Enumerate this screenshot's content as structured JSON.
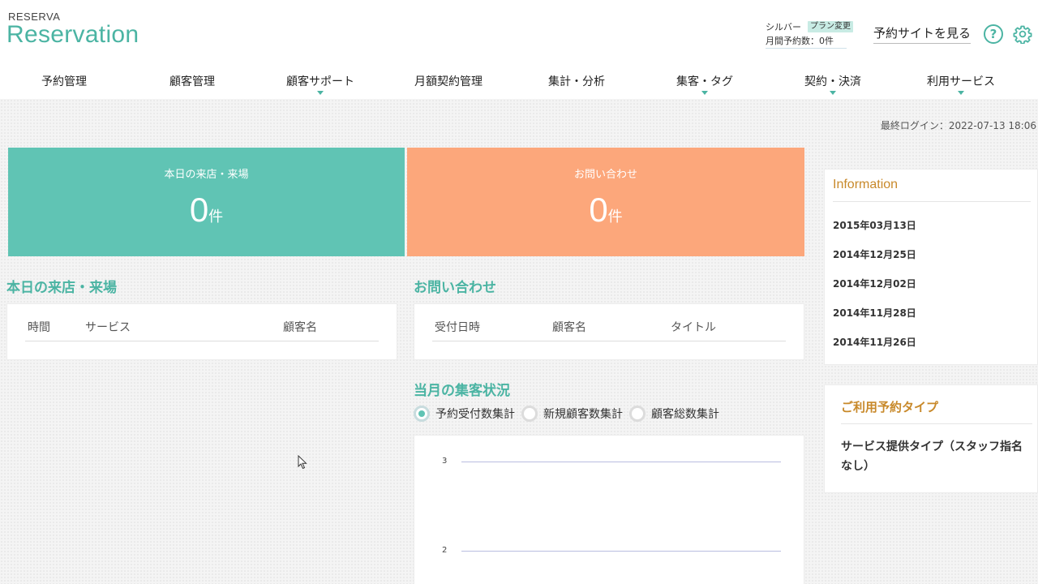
{
  "brand": {
    "small": "RESERVA",
    "big": "Reservation"
  },
  "plan": {
    "name": "シルバー",
    "change_label": "プラン変更",
    "monthly": "月間予約数：0件"
  },
  "header": {
    "view_site": "予約サイトを見る",
    "help_symbol": "?"
  },
  "icons": {
    "help": "question-circle-icon",
    "settings": "gear-icon",
    "cursor": "mouse-pointer-icon"
  },
  "nav": [
    {
      "label": "予約管理",
      "dropdown": false
    },
    {
      "label": "顧客管理",
      "dropdown": false
    },
    {
      "label": "顧客サポート",
      "dropdown": true
    },
    {
      "label": "月額契約管理",
      "dropdown": false
    },
    {
      "label": "集計・分析",
      "dropdown": false
    },
    {
      "label": "集客・タグ",
      "dropdown": true
    },
    {
      "label": "契約・決済",
      "dropdown": true
    },
    {
      "label": "利用サービス",
      "dropdown": true
    }
  ],
  "last_login": "最終ログイン：2022-07-13 18:06",
  "stats": {
    "visits": {
      "label": "本日の来店・来場",
      "value": "0",
      "unit": "件"
    },
    "inquiries": {
      "label": "お問い合わせ",
      "value": "0",
      "unit": "件"
    }
  },
  "visits_table": {
    "title": "本日の来店・来場",
    "headers": [
      "時間",
      "サービス",
      "顧客名"
    ]
  },
  "inquiries_table": {
    "title": "お問い合わせ",
    "headers": [
      "受付日時",
      "顧客名",
      "タイトル"
    ]
  },
  "monthly": {
    "title": "当月の集客状況",
    "options": [
      {
        "label": "予約受付数集計",
        "checked": true
      },
      {
        "label": "新規顧客数集計",
        "checked": false
      },
      {
        "label": "顧客総数集計",
        "checked": false
      }
    ]
  },
  "chart_data": {
    "type": "line",
    "title": "",
    "y_ticks": [
      "3",
      "2"
    ],
    "series": [],
    "grid": true
  },
  "information": {
    "title": "Information",
    "items": [
      "2015年03月13日",
      "2014年12月25日",
      "2014年12月02日",
      "2014年11月28日",
      "2014年11月26日"
    ]
  },
  "reservation_type": {
    "title": "ご利用予約タイプ",
    "value": "サービス提供タイプ（スタッフ指名なし）"
  },
  "colors": {
    "teal": "#60c4b4",
    "orange": "#fca77b",
    "gold": "#c8892a",
    "accent": "#4bb4a3"
  }
}
